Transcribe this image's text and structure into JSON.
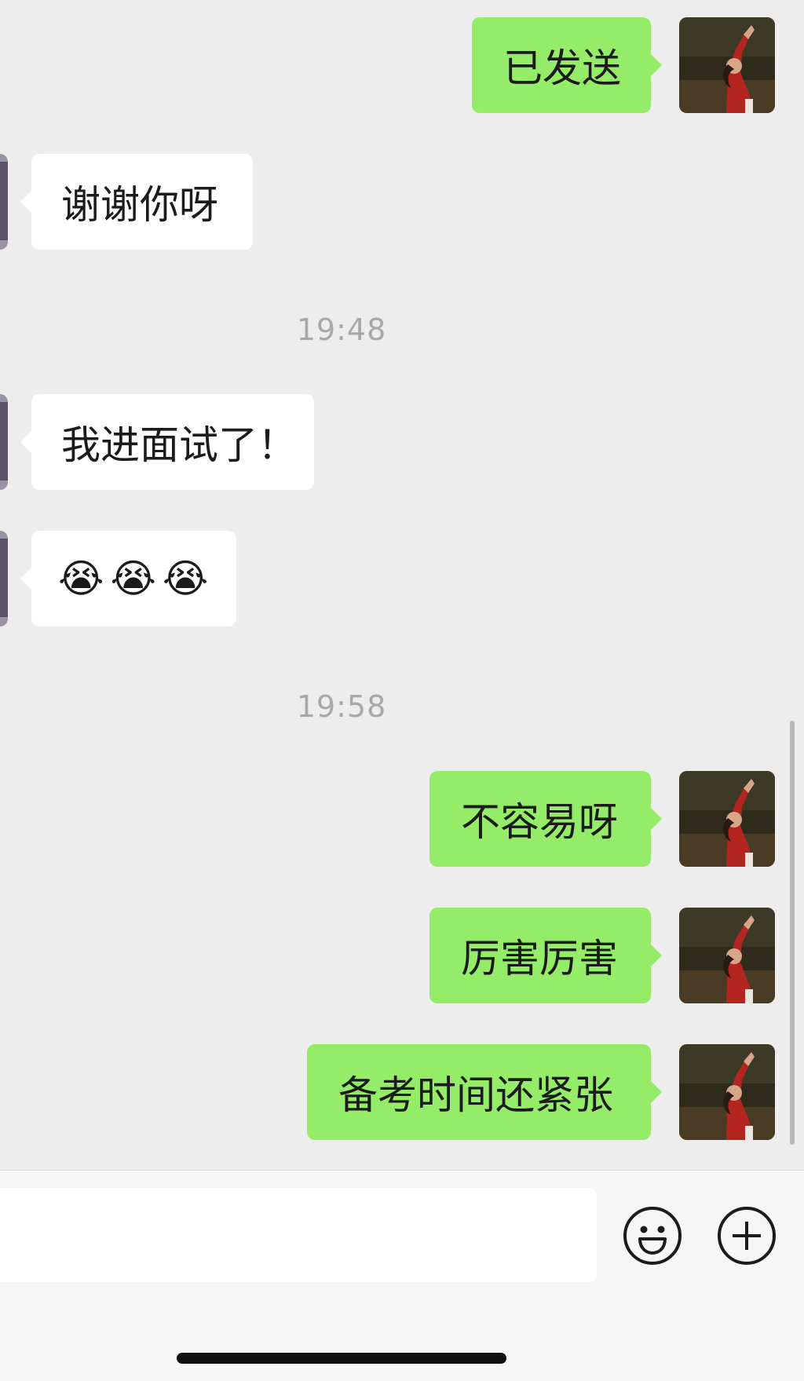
{
  "chat": {
    "timestamps": [
      "19:48",
      "19:58"
    ],
    "messages": [
      {
        "side": "out",
        "text": "已发送"
      },
      {
        "side": "in",
        "text": "谢谢你呀"
      },
      {
        "side": "in",
        "text": "我进面试了！"
      },
      {
        "side": "in",
        "emoji": [
          "😭",
          "😭",
          "😭"
        ]
      },
      {
        "side": "out",
        "text": "不容易呀"
      },
      {
        "side": "out",
        "text": "厉害厉害"
      },
      {
        "side": "out",
        "text": "备考时间还紧张"
      }
    ]
  },
  "input_bar": {
    "placeholder": "",
    "icons": [
      "emoji-icon",
      "plus-icon"
    ]
  },
  "colors": {
    "background": "#ededed",
    "out_bubble": "#95ec69",
    "in_bubble": "#ffffff",
    "timestamp": "#a8a8a8"
  }
}
